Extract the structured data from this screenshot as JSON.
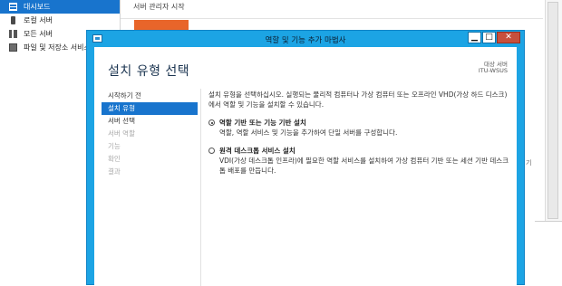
{
  "server_manager": {
    "nav_items": [
      {
        "label": "대시보드",
        "icon": "dashboard-icon",
        "active": true
      },
      {
        "label": "로컬 서버",
        "icon": "server-icon",
        "active": false
      },
      {
        "label": "모든 서버",
        "icon": "servers-icon",
        "active": false
      },
      {
        "label": "파일 및 저장소 서비스",
        "icon": "file-storage-icon",
        "active": false
      }
    ],
    "heading": "서버 관리자 시작",
    "peek_text": "기",
    "accent_color": "#e8652a"
  },
  "wizard": {
    "title": "역할 및 기능 추가 마법사",
    "controls": {
      "minimize": "▁",
      "maximize": "□",
      "close": "✕"
    },
    "page_heading": "설치 유형 선택",
    "destination_label": "대상 서버",
    "destination_server": "ITU-WSUS",
    "steps": [
      {
        "label": "시작하기 전",
        "state": "normal"
      },
      {
        "label": "설치 유형",
        "state": "active"
      },
      {
        "label": "서버 선택",
        "state": "normal"
      },
      {
        "label": "서버 역할",
        "state": "disabled"
      },
      {
        "label": "기능",
        "state": "disabled"
      },
      {
        "label": "확인",
        "state": "disabled"
      },
      {
        "label": "결과",
        "state": "disabled"
      }
    ],
    "description": "설치 유형을 선택하십시오. 실행되는 물리적 컴퓨터나 가상 컴퓨터 또는 오프라인 VHD(가상 하드 디스크)에서 역할 및 기능을 설치할 수 있습니다.",
    "options": [
      {
        "label": "역할 기반 또는 기능 기반 설치",
        "description": "역할, 역할 서비스 및 기능을 추가하여 단일 서버를 구성합니다.",
        "checked": true
      },
      {
        "label": "원격 데스크톱 서비스 설치",
        "description": "VDI(가상 데스크톱 인프라)에 필요한 역할 서비스를 설치하여 가상 컴퓨터 기반 또는 세션 기반 데스크톱 배포를 만듭니다.",
        "checked": false
      }
    ],
    "title_bar_color": "#1ca4e4",
    "selection_color": "#1874cd"
  }
}
